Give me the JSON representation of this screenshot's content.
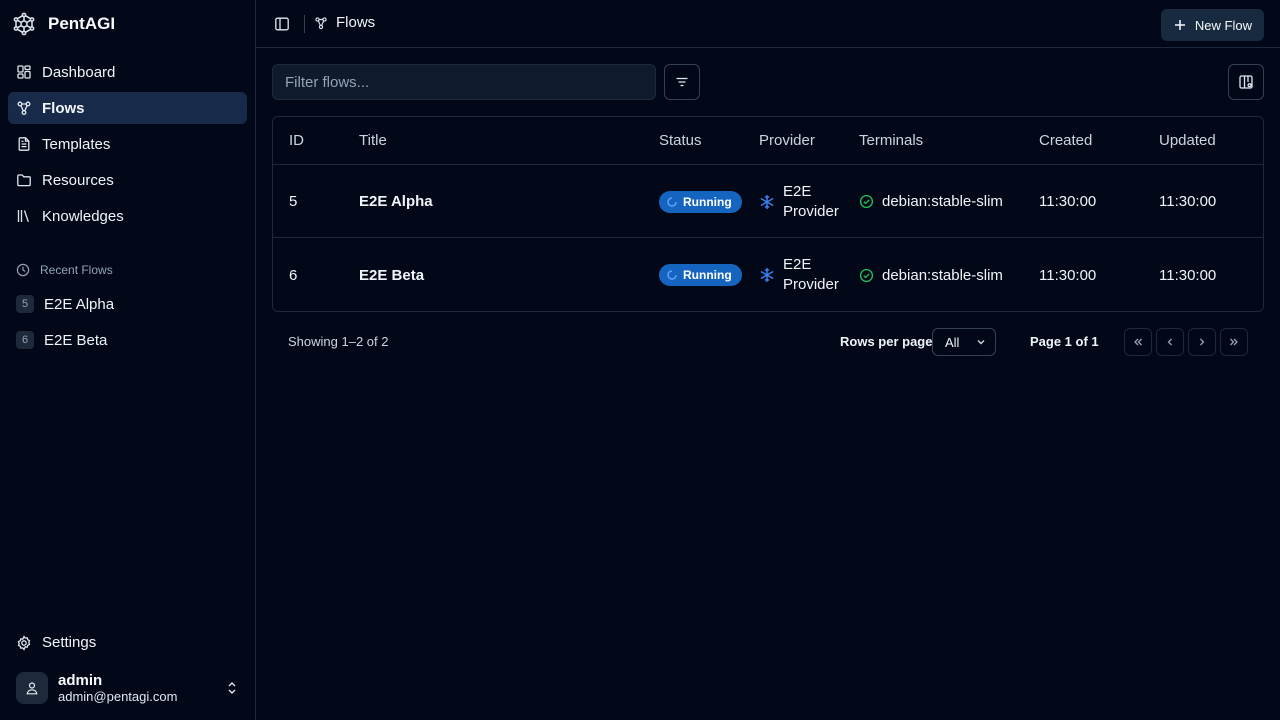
{
  "app": {
    "name": "PentAGI"
  },
  "sidebar": {
    "nav": [
      {
        "label": "Dashboard"
      },
      {
        "label": "Flows"
      },
      {
        "label": "Templates"
      },
      {
        "label": "Resources"
      },
      {
        "label": "Knowledges"
      }
    ],
    "recent_label": "Recent Flows",
    "recent": [
      {
        "id": "5",
        "label": "E2E Alpha"
      },
      {
        "id": "6",
        "label": "E2E Beta"
      }
    ],
    "settings_label": "Settings",
    "user": {
      "name": "admin",
      "email": "admin@pentagi.com"
    }
  },
  "header": {
    "breadcrumb": "Flows",
    "new_flow_label": "New Flow"
  },
  "filter": {
    "placeholder": "Filter flows..."
  },
  "table": {
    "columns": [
      "ID",
      "Title",
      "Status",
      "Provider",
      "Terminals",
      "Created",
      "Updated"
    ],
    "rows": [
      {
        "id": "5",
        "title": "E2E Alpha",
        "status": "Running",
        "provider_line1": "E2E",
        "provider_line2": "Provider",
        "terminal": "debian:stable-slim",
        "created": "11:30:00",
        "updated": "11:30:00"
      },
      {
        "id": "6",
        "title": "E2E Beta",
        "status": "Running",
        "provider_line1": "E2E",
        "provider_line2": "Provider",
        "terminal": "debian:stable-slim",
        "created": "11:30:00",
        "updated": "11:30:00"
      }
    ]
  },
  "pagination": {
    "showing": "Showing 1–2 of 2",
    "rows_per_page_label": "Rows per page",
    "rows_per_page_value": "All",
    "page_info": "Page 1 of 1"
  },
  "colors": {
    "background": "#020817",
    "active_nav": "#172a4a",
    "status_running": "#1565c0",
    "terminal_ok": "#22c55e",
    "provider_icon": "#3b82f6"
  }
}
